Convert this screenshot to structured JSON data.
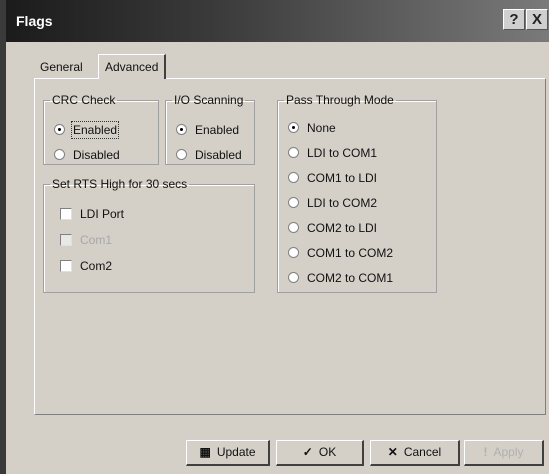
{
  "window": {
    "title": "Flags",
    "help_glyph": "?",
    "close_glyph": "X"
  },
  "tabs": [
    {
      "label": "General",
      "active": false
    },
    {
      "label": "Advanced",
      "active": true
    }
  ],
  "crc_check": {
    "legend": "CRC Check",
    "options": [
      {
        "label": "Enabled",
        "selected": true
      },
      {
        "label": "Disabled",
        "selected": false
      }
    ]
  },
  "io_scanning": {
    "legend": "I/O Scanning",
    "options": [
      {
        "label": "Enabled",
        "selected": true
      },
      {
        "label": "Disabled",
        "selected": false
      }
    ]
  },
  "rts": {
    "legend": "Set RTS High for 30 secs",
    "options": [
      {
        "label": "LDI Port",
        "checked": false,
        "enabled": true
      },
      {
        "label": "Com1",
        "checked": false,
        "enabled": false
      },
      {
        "label": "Com2",
        "checked": false,
        "enabled": true
      }
    ]
  },
  "pass_through": {
    "legend": "Pass Through Mode",
    "options": [
      {
        "label": "None",
        "selected": true
      },
      {
        "label": "LDI to COM1",
        "selected": false
      },
      {
        "label": "COM1 to LDI",
        "selected": false
      },
      {
        "label": "LDI to COM2",
        "selected": false
      },
      {
        "label": "COM2 to LDI",
        "selected": false
      },
      {
        "label": "COM1 to COM2",
        "selected": false
      },
      {
        "label": "COM2 to COM1",
        "selected": false
      }
    ]
  },
  "buttons": {
    "update": {
      "label": "Update",
      "icon": "update-icon"
    },
    "ok": {
      "label": "OK",
      "icon": "checkmark-icon"
    },
    "cancel": {
      "label": "Cancel",
      "icon": "x-icon"
    },
    "apply": {
      "label": "Apply",
      "icon": "exclamation-icon",
      "enabled": false
    }
  }
}
